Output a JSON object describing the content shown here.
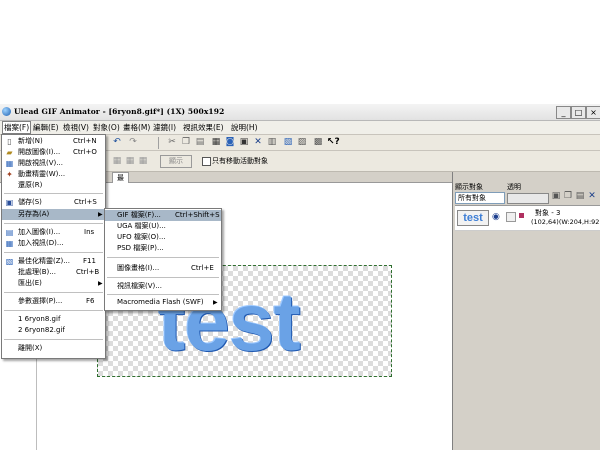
{
  "title": "Ulead GIF Animator - [6ryon8.gif*] (1X) 500x192",
  "window_buttons": [
    "_",
    "□",
    "×"
  ],
  "menubar": [
    "檔案(F)",
    "編輯(E)",
    "檢視(V)",
    "對象(O)",
    "畫格(M)",
    "濾鏡(I)",
    "視訊效果(E)",
    "說明(H)"
  ],
  "toolbar2": {
    "button": "顯示",
    "checkbox_label": "只有移動活動對象"
  },
  "tab_label": "最",
  "file_menu": [
    {
      "label": "新增(N)",
      "shortcut": "Ctrl+N",
      "icon": "new-file-icon"
    },
    {
      "label": "開啟圖像(I)...",
      "shortcut": "Ctrl+O",
      "icon": "open-image-icon"
    },
    {
      "label": "開啟視訊(V)...",
      "shortcut": "",
      "icon": "open-video-icon"
    },
    {
      "label": "動畫精靈(W)...",
      "shortcut": "",
      "icon": "wizard-icon"
    },
    {
      "label": "還原(R)",
      "shortcut": "",
      "icon": ""
    },
    {
      "label": "儲存(S)",
      "shortcut": "Ctrl+S",
      "icon": "save-icon"
    },
    {
      "label": "另存為(A)",
      "shortcut": "",
      "icon": ""
    },
    {
      "label": "加入圖像(I)...",
      "shortcut": "Ins",
      "icon": "add-image-icon"
    },
    {
      "label": "加入視訊(D)...",
      "shortcut": "",
      "icon": "add-video-icon"
    },
    {
      "label": "最佳化精靈(Z)...",
      "shortcut": "F11",
      "icon": "optimize-icon"
    },
    {
      "label": "批處理(B)...",
      "shortcut": "Ctrl+B",
      "icon": ""
    },
    {
      "label": "匯出(E)",
      "shortcut": "",
      "icon": ""
    },
    {
      "label": "參數選擇(P)...",
      "shortcut": "F6",
      "icon": ""
    },
    {
      "label": "1 6ryon8.gif",
      "shortcut": "",
      "icon": ""
    },
    {
      "label": "2 6ryon82.gif",
      "shortcut": "",
      "icon": ""
    },
    {
      "label": "離開(X)",
      "shortcut": "",
      "icon": ""
    }
  ],
  "saveas_menu": [
    {
      "label": "GIF 檔案(F)...",
      "shortcut": "Ctrl+Shift+S"
    },
    {
      "label": "UGA 檔案(U)...",
      "shortcut": ""
    },
    {
      "label": "UFO 檔案(O)...",
      "shortcut": ""
    },
    {
      "label": "PSD 檔案(P)...",
      "shortcut": ""
    },
    {
      "label": "圖像畫格(I)...",
      "shortcut": "Ctrl+E"
    },
    {
      "label": "視訊檔案(V)...",
      "shortcut": ""
    },
    {
      "label": "Macromedia Flash (SWF)",
      "shortcut": ""
    }
  ],
  "canvas_text": "test",
  "right_panel": {
    "show_label": "顯示對象",
    "opacity_label": "透明",
    "dropdown": "所有對象",
    "object_name": "對象 - 3",
    "object_info": "(102,64)(W:204,H:92",
    "thumb_text": "test"
  },
  "colors": {
    "accent": "#a8b8c8",
    "canvas_text": "#6aa2e6",
    "chrome": "#d4d0c8"
  }
}
